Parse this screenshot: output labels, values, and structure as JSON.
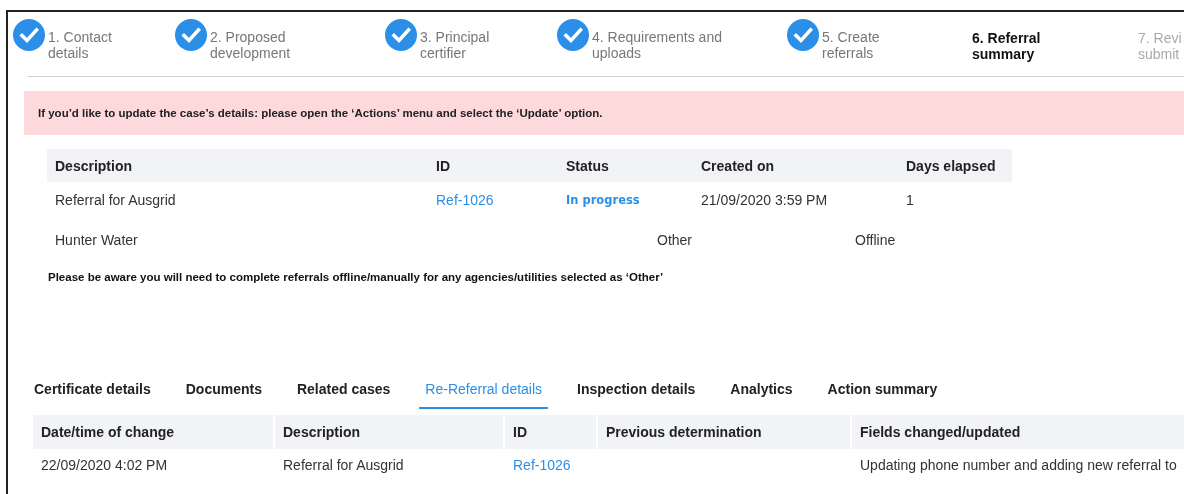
{
  "steps": [
    {
      "number": "1.",
      "label": "Contact details",
      "completed": true,
      "current": false
    },
    {
      "number": "2.",
      "label": "Proposed development",
      "completed": true,
      "current": false
    },
    {
      "number": "3.",
      "label": "Principal certifier",
      "completed": true,
      "current": false
    },
    {
      "number": "4.",
      "label": "Requirements and uploads",
      "completed": true,
      "current": false
    },
    {
      "number": "5.",
      "label": "Create referrals",
      "completed": true,
      "current": false
    },
    {
      "number": "6.",
      "label": "Referral summary",
      "completed": false,
      "current": true
    },
    {
      "number": "7.",
      "label": "Revi submit",
      "completed": false,
      "current": false
    }
  ],
  "alert": "If you’d like to update the case’s details: please open the ‘Actions’ menu and select the ‘Update’ option.",
  "referrals": {
    "columns": [
      "Description",
      "ID",
      "Status",
      "Created on",
      "Days elapsed"
    ],
    "rows": [
      {
        "description": "Referral for Ausgrid",
        "id": "Ref-1026",
        "status": "In progress",
        "created_on": "21/09/2020 3:59 PM",
        "days_elapsed": "1"
      }
    ]
  },
  "other_referrals": [
    {
      "agency": "Hunter Water",
      "type": "Other",
      "mode": "Offline"
    }
  ],
  "note": "Please be aware you will need to complete referrals offline/manually for any agencies/utilities selected as ‘Other’",
  "tabs": [
    {
      "label": "Certificate details",
      "selected": false
    },
    {
      "label": "Documents",
      "selected": false
    },
    {
      "label": "Related cases",
      "selected": false
    },
    {
      "label": "Re-Referral details",
      "selected": true
    },
    {
      "label": "Inspection details",
      "selected": false
    },
    {
      "label": "Analytics",
      "selected": false
    },
    {
      "label": "Action summary",
      "selected": false
    }
  ],
  "history": {
    "columns": [
      "Date/time of change",
      "Description",
      "ID",
      "Previous determination",
      "Fields changed/updated"
    ],
    "rows": [
      {
        "changed": "22/09/2020 4:02 PM",
        "description": "Referral for Ausgrid",
        "id": "Ref-1026",
        "fields": "Updating phone number and adding new referral to"
      }
    ]
  }
}
